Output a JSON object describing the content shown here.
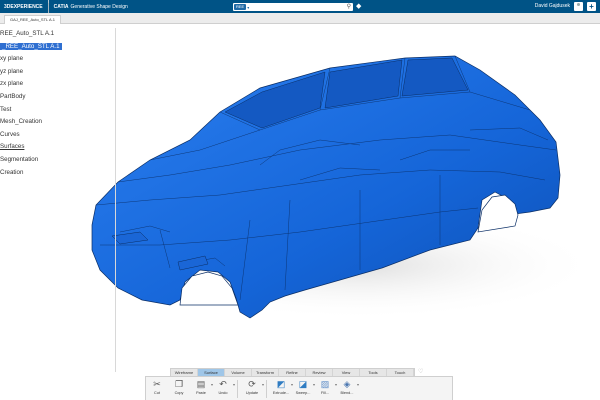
{
  "topbar": {
    "brand_3d": "3DEXPERIENCE",
    "separator": "|",
    "brand_app": "CATIA",
    "app_name": "Generative Shape Design",
    "search_scope": "REE",
    "user_name": "David Gajdusek"
  },
  "tab": {
    "label": "GAJ_REE_Auto_STL A.1"
  },
  "tree": {
    "items": [
      {
        "label": "REE_Auto_STL A.1",
        "style": "normal"
      },
      {
        "label": "_REE_Auto_STL A.1",
        "style": "selected"
      },
      {
        "label": "xy plane",
        "style": "normal"
      },
      {
        "label": "yz plane",
        "style": "normal"
      },
      {
        "label": "zx plane",
        "style": "normal"
      },
      {
        "label": "PartBody",
        "style": "normal"
      },
      {
        "label": "Test",
        "style": "normal"
      },
      {
        "label": "Mesh_Creation",
        "style": "normal"
      },
      {
        "label": "Curves",
        "style": "normal"
      },
      {
        "label": "Surfaces",
        "style": "underline"
      },
      {
        "label": "Segmentation",
        "style": "normal"
      },
      {
        "label": "Creation",
        "style": "normal"
      }
    ]
  },
  "section_tabs": [
    "Wireframe",
    "Surface",
    "Volume",
    "Transform",
    "Refine",
    "Review",
    "View",
    "Tools",
    "Touch"
  ],
  "active_section": "Surface",
  "actions": [
    {
      "label": "Cut",
      "icon": "scissors-icon"
    },
    {
      "label": "Copy",
      "icon": "copy-icon"
    },
    {
      "label": "Paste",
      "icon": "paste-icon"
    },
    {
      "label": "Undo",
      "icon": "undo-icon"
    },
    {
      "label": "Update",
      "icon": "update-icon"
    },
    {
      "label": "Extrude...",
      "icon": "extrude-icon"
    },
    {
      "label": "Sweep...",
      "icon": "sweep-icon"
    },
    {
      "label": "Fill...",
      "icon": "fill-icon"
    },
    {
      "label": "Blend...",
      "icon": "blend-icon"
    }
  ],
  "colors": {
    "topbar": "#005386",
    "model_blue": "#1565d8",
    "selection": "#2f6fd1",
    "active_tab": "#9fc6e8"
  }
}
